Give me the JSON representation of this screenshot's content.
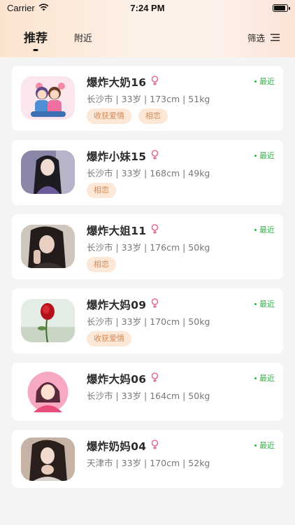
{
  "status_bar": {
    "carrier": "Carrier",
    "time": "7:24 PM",
    "battery_level": 0.9
  },
  "tabs": [
    {
      "label": "推荐",
      "active": true
    },
    {
      "label": "附近",
      "active": false
    }
  ],
  "filter": {
    "label": "筛选",
    "icon": "menu-lines-icon"
  },
  "gender_icon": "♀",
  "colors": {
    "accent_tag_text": "#d18a55",
    "tag_bg": "#fde7d6",
    "online_green": "#34b34a",
    "female_pink": "#e86a9a"
  },
  "users": [
    {
      "name": "爆炸大奶16",
      "details": "长沙市 | 33岁 | 173cm | 51kg",
      "tags": [
        "收获爱情",
        "相恋"
      ],
      "status": "最近",
      "avatar": "couple-illustration"
    },
    {
      "name": "爆炸小妹15",
      "details": "长沙市 | 33岁 | 168cm | 49kg",
      "tags": [
        "相恋"
      ],
      "status": "最近",
      "avatar": "woman-photo"
    },
    {
      "name": "爆炸大姐11",
      "details": "长沙市 | 33岁 | 176cm | 50kg",
      "tags": [
        "相恋"
      ],
      "status": "最近",
      "avatar": "woman-photo"
    },
    {
      "name": "爆炸大妈09",
      "details": "长沙市 | 33岁 | 170cm | 50kg",
      "tags": [
        "收获爱情"
      ],
      "status": "最近",
      "avatar": "red-rose-photo"
    },
    {
      "name": "爆炸大妈06",
      "details": "长沙市 | 33岁 | 164cm | 50kg",
      "tags": [],
      "status": "最近",
      "avatar": "default-female-avatar"
    },
    {
      "name": "爆炸奶妈04",
      "details": "天津市 | 33岁 | 170cm | 52kg",
      "tags": [],
      "status": "最近",
      "avatar": "woman-photo"
    }
  ]
}
